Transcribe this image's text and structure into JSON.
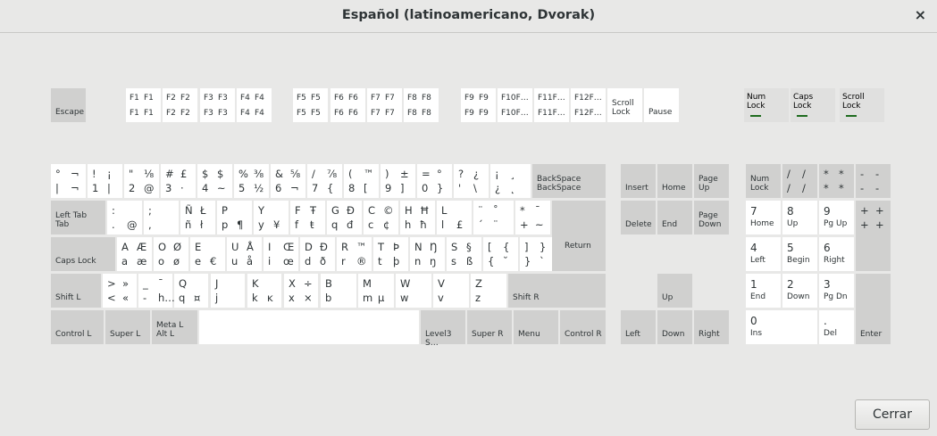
{
  "window": {
    "title": "Español (latinoamericano, Dvorak)",
    "close_glyph": "×"
  },
  "footer": {
    "close_label": "Cerrar"
  },
  "leds": [
    {
      "name": "num-lock-led",
      "lines": [
        "Num",
        "Lock"
      ]
    },
    {
      "name": "caps-lock-led",
      "lines": [
        "Caps",
        "Lock"
      ]
    },
    {
      "name": "scroll-lock-led",
      "lines": [
        "Scroll",
        "Lock"
      ]
    }
  ],
  "keys": {
    "escape": [
      "Escape"
    ],
    "f1": [
      "F1",
      "F1",
      "F1",
      "F1"
    ],
    "f2": [
      "F2",
      "F2",
      "F2",
      "F2"
    ],
    "f3": [
      "F3",
      "F3",
      "F3",
      "F3"
    ],
    "f4": [
      "F4",
      "F4",
      "F4",
      "F4"
    ],
    "f5": [
      "F5",
      "F5",
      "F5",
      "F5"
    ],
    "f6": [
      "F6",
      "F6",
      "F6",
      "F6"
    ],
    "f7": [
      "F7",
      "F7",
      "F7",
      "F7"
    ],
    "f8": [
      "F8",
      "F8",
      "F8",
      "F8"
    ],
    "f9": [
      "F9",
      "F9",
      "F9",
      "F9"
    ],
    "f10": [
      "F10F…",
      "",
      "F10F…",
      ""
    ],
    "f11": [
      "F11F…",
      "",
      "F11F…",
      ""
    ],
    "f12": [
      "F12F…",
      "",
      "F12F…",
      ""
    ],
    "scroll-lock": [
      "Scroll",
      "Lock"
    ],
    "pause": [
      "Pause"
    ],
    "grave": [
      "°",
      "¬",
      "|",
      "¬"
    ],
    "k1": [
      "!",
      "¡",
      "1",
      "|"
    ],
    "k2": [
      "\"",
      "⅛",
      "2",
      "@"
    ],
    "k3": [
      "#",
      "£",
      "3",
      "·"
    ],
    "k4": [
      "$",
      "$",
      "4",
      "~"
    ],
    "k5": [
      "%",
      "⅜",
      "5",
      "½"
    ],
    "k6": [
      "&",
      "⅝",
      "6",
      "¬"
    ],
    "k7": [
      "/",
      "⅞",
      "7",
      "{"
    ],
    "k8": [
      "(",
      "™",
      "8",
      "["
    ],
    "k9": [
      ")",
      "±",
      "9",
      "]"
    ],
    "k0": [
      "=",
      "°",
      "0",
      "}"
    ],
    "apos": [
      "?",
      "¿",
      "'",
      "\\"
    ],
    "iquest": [
      "¡",
      "¸",
      "¿",
      "˛"
    ],
    "backspace": [
      "BackSpace",
      "BackSpace"
    ],
    "tab": [
      "Left Tab",
      "Tab"
    ],
    "colon": [
      ":",
      "",
      ".",
      "@"
    ],
    "semi": [
      ";",
      "",
      ",",
      ""
    ],
    "ntilde": [
      "Ñ",
      "Ł",
      "ñ",
      "ł"
    ],
    "p": [
      "P",
      "",
      "p",
      "¶"
    ],
    "y": [
      "Y",
      "",
      "y",
      "¥"
    ],
    "f": [
      "F",
      "Ŧ",
      "f",
      "ŧ"
    ],
    "g": [
      "G",
      "Đ",
      "q",
      "đ"
    ],
    "c": [
      "C",
      "©",
      "c",
      "¢"
    ],
    "h": [
      "H",
      "Ħ",
      "h",
      "ħ"
    ],
    "l": [
      "L",
      "",
      "l",
      "£"
    ],
    "dead": [
      "¨",
      "˚",
      "´",
      "¨"
    ],
    "star": [
      "*",
      "¯",
      "+",
      "~"
    ],
    "caps": [
      "Caps Lock"
    ],
    "a": [
      "A",
      "Æ",
      "a",
      "æ"
    ],
    "o": [
      "O",
      "Ø",
      "o",
      "ø"
    ],
    "e": [
      "E",
      "",
      "e",
      "€"
    ],
    "u": [
      "U",
      "Å",
      "u",
      "å"
    ],
    "i": [
      "I",
      "Œ",
      "i",
      "œ"
    ],
    "d": [
      "D",
      "Đ",
      "d",
      "ð"
    ],
    "r": [
      "R",
      "™",
      "r",
      "®"
    ],
    "t": [
      "T",
      "Þ",
      "t",
      "þ"
    ],
    "n": [
      "N",
      "Ŋ",
      "n",
      "ŋ"
    ],
    "s": [
      "S",
      "§",
      "s",
      "ß"
    ],
    "brace": [
      "[",
      "{",
      "{",
      "˘"
    ],
    "bracket": [
      "]",
      "}",
      "}",
      "`"
    ],
    "return": [
      "Return"
    ],
    "shift-l": [
      "Shift L"
    ],
    "lt": [
      ">",
      "»",
      "<",
      "«"
    ],
    "minus": [
      "_",
      "¯",
      "-",
      "h…"
    ],
    "q": [
      "Q",
      "",
      "q",
      "¤"
    ],
    "j": [
      "J",
      "",
      "j",
      ""
    ],
    "k": [
      "K",
      "",
      "k",
      "ĸ"
    ],
    "x": [
      "X",
      "÷",
      "x",
      "×"
    ],
    "b": [
      "B",
      "",
      "b",
      ""
    ],
    "m": [
      "M",
      "",
      "m",
      "µ"
    ],
    "w": [
      "W",
      "",
      "w",
      ""
    ],
    "v": [
      "V",
      "",
      "v",
      ""
    ],
    "z": [
      "Z",
      "",
      "z",
      ""
    ],
    "shift-r": [
      "Shift R"
    ],
    "ctrl-l": [
      "Control L"
    ],
    "super-l": [
      "Super L"
    ],
    "meta-l": [
      "Meta L",
      "Alt L"
    ],
    "space": [
      ""
    ],
    "level3": [
      "Level3 S…"
    ],
    "super-r": [
      "Super R"
    ],
    "menu": [
      "Menu"
    ],
    "ctrl-r": [
      "Control R"
    ],
    "insert": [
      "Insert"
    ],
    "home": [
      "Home"
    ],
    "page-up": [
      "Page",
      "Up"
    ],
    "delete": [
      "Delete"
    ],
    "end": [
      "End"
    ],
    "page-down": [
      "Page",
      "Down"
    ],
    "up": [
      "Up"
    ],
    "left": [
      "Left"
    ],
    "down": [
      "Down"
    ],
    "right": [
      "Right"
    ],
    "numlock": [
      "Num",
      "Lock"
    ],
    "kp-div": [
      "/",
      "/",
      "/",
      "/"
    ],
    "kp-mul": [
      "*",
      "*",
      "*",
      "*"
    ],
    "kp-sub": [
      "-",
      "-",
      "-",
      "-"
    ],
    "kp7": [
      "7",
      "Home"
    ],
    "kp8": [
      "8",
      "Up"
    ],
    "kp9": [
      "9",
      "Pg Up"
    ],
    "kp-add": [
      "+",
      "+",
      "+",
      "+"
    ],
    "kp4": [
      "4",
      "Left"
    ],
    "kp5": [
      "5",
      "Begin"
    ],
    "kp6": [
      "6",
      "Right"
    ],
    "kp1": [
      "1",
      "End"
    ],
    "kp2": [
      "2",
      "Down"
    ],
    "kp3": [
      "3",
      "Pg Dn"
    ],
    "kp-enter": [
      "Enter"
    ],
    "kp0": [
      "0",
      "Ins"
    ],
    "kp-dot": [
      ".",
      "Del"
    ]
  }
}
